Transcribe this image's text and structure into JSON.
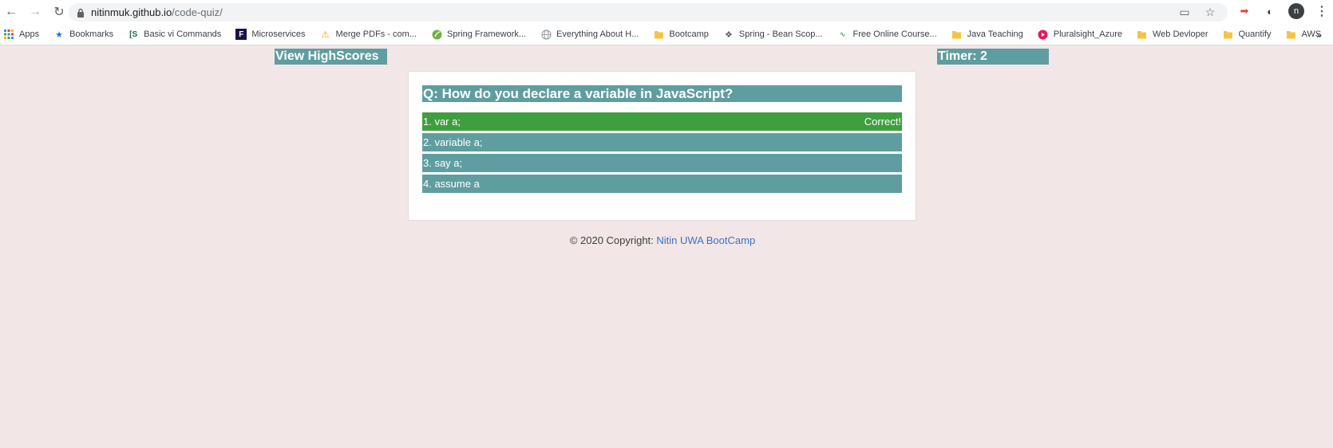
{
  "browser": {
    "url_host": "nitinmuk.github.io",
    "url_path": "/code-quiz/",
    "profile_initial": "n",
    "bookmarks": [
      {
        "label": "Apps",
        "icon": "apps-grid-icon",
        "color": "#4285f4"
      },
      {
        "label": "Bookmarks",
        "icon": "star-icon",
        "color": "#1a73e8"
      },
      {
        "label": "Basic vi Commands",
        "icon": "cs-logo-icon",
        "color": "#1e6b52"
      },
      {
        "label": "Microservices",
        "icon": "f-logo-icon",
        "color": "#1a1446"
      },
      {
        "label": "Merge PDFs - com...",
        "icon": "warning-triangle-icon",
        "color": "#f4a100"
      },
      {
        "label": "Spring Framework...",
        "icon": "spring-leaf-icon",
        "color": "#6db33f"
      },
      {
        "label": "Everything About H...",
        "icon": "globe-icon",
        "color": "#9aa0a6"
      },
      {
        "label": "Bootcamp",
        "icon": "folder-icon",
        "color": "#f4c542"
      },
      {
        "label": "Spring - Bean Scop...",
        "icon": "diamond-icon",
        "color": "#5f6368"
      },
      {
        "label": "Free Online Course...",
        "icon": "wings-icon",
        "color": "#2e7d32"
      },
      {
        "label": "Java Teaching",
        "icon": "folder-icon",
        "color": "#f4c542"
      },
      {
        "label": "Pluralsight_Azure",
        "icon": "play-circle-icon",
        "color": "#e8175d"
      },
      {
        "label": "Web Devloper",
        "icon": "folder-icon",
        "color": "#f4c542"
      },
      {
        "label": "Quantify",
        "icon": "folder-icon",
        "color": "#f4c542"
      },
      {
        "label": "AWS",
        "icon": "folder-icon",
        "color": "#f4c542"
      }
    ],
    "more_label": "»"
  },
  "header": {
    "view_highscores": "View HighScores",
    "timer": "Timer: 2"
  },
  "quiz": {
    "question": "Q: How do you declare a variable in JavaScript?",
    "answers": [
      {
        "label": "1. var a;",
        "feedback": "Correct!"
      },
      {
        "label": "2. variable a;",
        "feedback": ""
      },
      {
        "label": "3. say a;",
        "feedback": ""
      },
      {
        "label": "4. assume a",
        "feedback": ""
      }
    ]
  },
  "footer": {
    "text": "© 2020 Copyright: ",
    "link": "Nitin UWA BootCamp"
  },
  "colors": {
    "accent": "#5f9ea0",
    "correct": "#3f9e3f",
    "page_bg": "#f2e6e6",
    "link": "#3b73c9"
  }
}
